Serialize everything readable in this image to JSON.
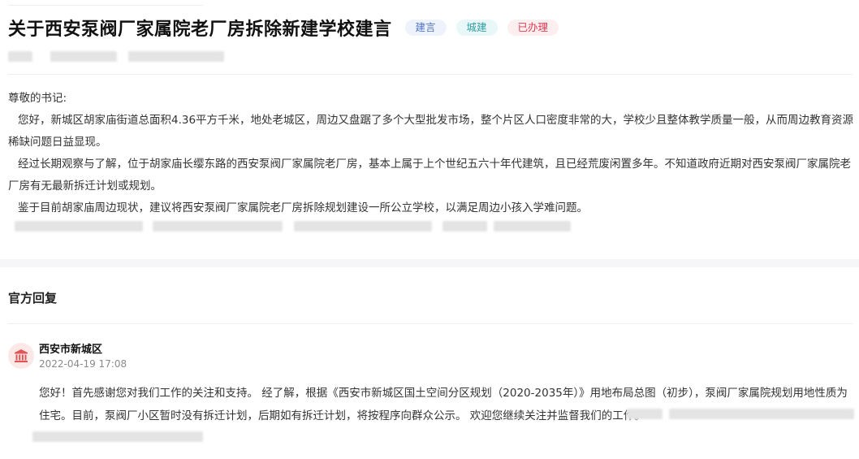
{
  "header": {
    "title": "关于西安泵阀厂家属院老厂房拆除新建学校建言",
    "tags": [
      {
        "label": "建言",
        "color": "#4f73c6"
      },
      {
        "label": "城建",
        "color": "#2e9ea5"
      },
      {
        "label": "已办理",
        "color": "#dd3a52"
      }
    ]
  },
  "message": {
    "salutation": "尊敬的书记:",
    "paragraphs": [
      "您好，新城区胡家庙街道总面积4.36平方千米，地处老城区，周边又盘踞了多个大型批发市场，整个片区人口密度非常的大，学校少且整体教学质量一般，从而周边教育资源稀缺问题日益显现。",
      "经过长期观察与了解，位于胡家庙长缨东路的西安泵阀厂家属院老厂房，基本上属于上个世纪五六十年代建筑，且已经荒废闲置多年。不知道政府近期对西安泵阀厂家属院老厂房有无最新拆迁计划或规划。",
      "鉴于目前胡家庙周边现状，建议将西安泵阀厂家属院老厂房拆除规划建设一所公立学校，以满足周边小孩入学难问题。"
    ]
  },
  "reply_section": {
    "title": "官方回复",
    "org": "西安市新城区",
    "date": "2022-04-19 17:08",
    "avatar_icon": "government-building-icon",
    "text": "您好！首先感谢您对我们工作的关注和支持。 经了解，根据《西安市新城区国土空间分区规划（2020-2035年）》用地布局总图（初步），泵阀厂家属院规划用地性质为住宅。目前，泵阀厂小区暂时没有拆迁计划，后期如有拆迁计划，将按程序向群众公示。 欢迎您继续关注并监督我们的工作。"
  },
  "colors": {
    "accent_red": "#dd3a52",
    "tag_blue": "#4f73c6",
    "tag_cyan": "#2e9ea5"
  }
}
